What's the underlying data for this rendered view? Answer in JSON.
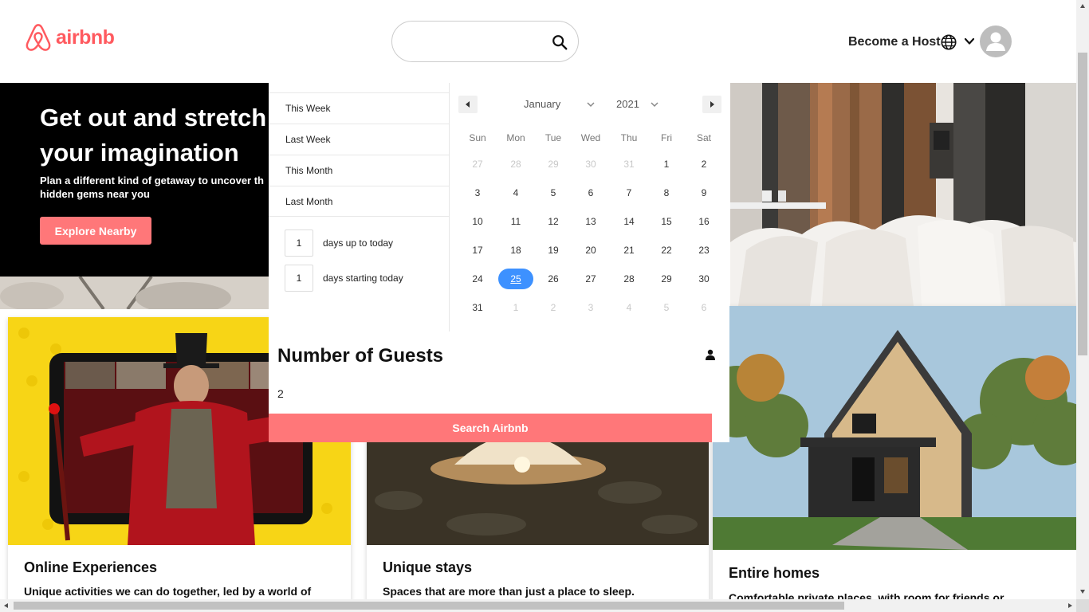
{
  "header": {
    "logo_text": "airbnb",
    "search": {
      "value": "",
      "placeholder": ""
    },
    "host_label": "Become a Host",
    "brand_color": "#ff5a5f"
  },
  "hero": {
    "title": "Get out and stretch\nyour imagination",
    "subtitle": "Plan a different kind of getaway to uncover th\nhidden gems near you",
    "button_label": "Explore Nearby"
  },
  "date_picker": {
    "presets": [
      "This Week",
      "Last Week",
      "This Month",
      "Last Month"
    ],
    "days_up_to_today": {
      "value": "1",
      "label": "days up to today"
    },
    "days_starting_today": {
      "value": "1",
      "label": "days starting today"
    },
    "month": "January",
    "year": "2021",
    "weekdays": [
      "Sun",
      "Mon",
      "Tue",
      "Wed",
      "Thu",
      "Fri",
      "Sat"
    ],
    "weeks": [
      [
        "27",
        "28",
        "29",
        "30",
        "31",
        "1",
        "2"
      ],
      [
        "3",
        "4",
        "5",
        "6",
        "7",
        "8",
        "9"
      ],
      [
        "10",
        "11",
        "12",
        "13",
        "14",
        "15",
        "16"
      ],
      [
        "17",
        "18",
        "19",
        "20",
        "21",
        "22",
        "23"
      ],
      [
        "24",
        "25",
        "26",
        "27",
        "28",
        "29",
        "30"
      ],
      [
        "31",
        "1",
        "2",
        "3",
        "4",
        "5",
        "6"
      ]
    ],
    "selected_day": "25",
    "selected_color": "#3d91ff"
  },
  "guests": {
    "title": "Number of Guests",
    "value": "2",
    "search_button": "Search Airbnb",
    "button_color": "#ff7779"
  },
  "cards": [
    {
      "title": "Online Experiences",
      "description": "Unique activities we can do together, led by a world of"
    },
    {
      "title": "Unique stays",
      "description": "Spaces that are more than just a place to sleep."
    },
    {
      "title": "Entire homes",
      "description": "Comfortable private places, with room for friends or"
    }
  ]
}
